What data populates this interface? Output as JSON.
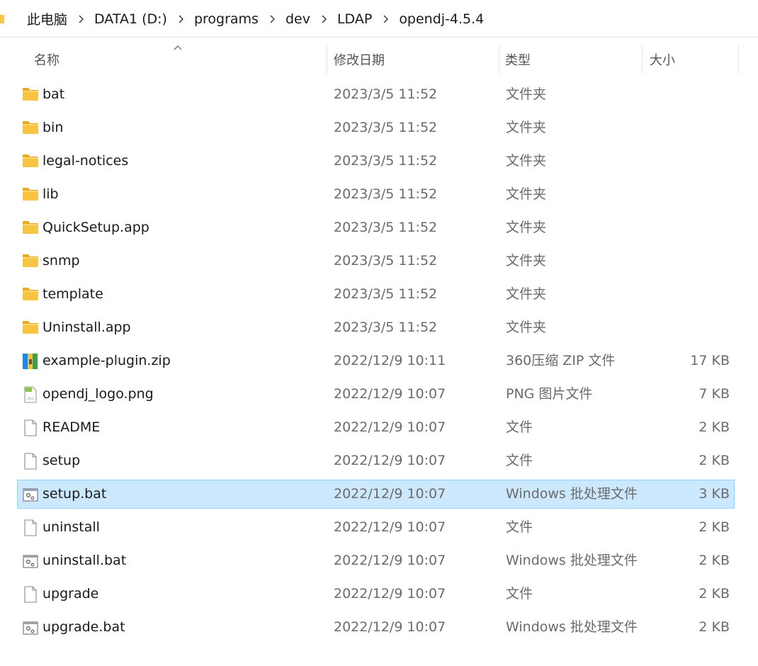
{
  "breadcrumb": [
    "此电脑",
    "DATA1 (D:)",
    "programs",
    "dev",
    "LDAP",
    "opendj-4.5.4"
  ],
  "columns": {
    "name": "名称",
    "modified": "修改日期",
    "type": "类型",
    "size": "大小"
  },
  "colors": {
    "selection_bg": "#cce8ff",
    "selection_border": "#99d1ff",
    "folder": "#f8c542"
  },
  "files": [
    {
      "name": "bat",
      "modified": "2023/3/5 11:52",
      "type": "文件夹",
      "size": "",
      "icon": "folder-icon"
    },
    {
      "name": "bin",
      "modified": "2023/3/5 11:52",
      "type": "文件夹",
      "size": "",
      "icon": "folder-icon"
    },
    {
      "name": "legal-notices",
      "modified": "2023/3/5 11:52",
      "type": "文件夹",
      "size": "",
      "icon": "folder-icon"
    },
    {
      "name": "lib",
      "modified": "2023/3/5 11:52",
      "type": "文件夹",
      "size": "",
      "icon": "folder-icon"
    },
    {
      "name": "QuickSetup.app",
      "modified": "2023/3/5 11:52",
      "type": "文件夹",
      "size": "",
      "icon": "folder-icon"
    },
    {
      "name": "snmp",
      "modified": "2023/3/5 11:52",
      "type": "文件夹",
      "size": "",
      "icon": "folder-icon"
    },
    {
      "name": "template",
      "modified": "2023/3/5 11:52",
      "type": "文件夹",
      "size": "",
      "icon": "folder-icon"
    },
    {
      "name": "Uninstall.app",
      "modified": "2023/3/5 11:52",
      "type": "文件夹",
      "size": "",
      "icon": "folder-icon"
    },
    {
      "name": "example-plugin.zip",
      "modified": "2022/12/9 10:11",
      "type": "360压缩 ZIP 文件",
      "size": "17 KB",
      "icon": "zip-archive-icon"
    },
    {
      "name": "opendj_logo.png",
      "modified": "2022/12/9 10:07",
      "type": "PNG 图片文件",
      "size": "7 KB",
      "icon": "image-file-icon"
    },
    {
      "name": "README",
      "modified": "2022/12/9 10:07",
      "type": "文件",
      "size": "2 KB",
      "icon": "file-icon"
    },
    {
      "name": "setup",
      "modified": "2022/12/9 10:07",
      "type": "文件",
      "size": "2 KB",
      "icon": "file-icon"
    },
    {
      "name": "setup.bat",
      "modified": "2022/12/9 10:07",
      "type": "Windows 批处理文件",
      "size": "3 KB",
      "icon": "batch-file-icon",
      "selected": true
    },
    {
      "name": "uninstall",
      "modified": "2022/12/9 10:07",
      "type": "文件",
      "size": "2 KB",
      "icon": "file-icon"
    },
    {
      "name": "uninstall.bat",
      "modified": "2022/12/9 10:07",
      "type": "Windows 批处理文件",
      "size": "2 KB",
      "icon": "batch-file-icon"
    },
    {
      "name": "upgrade",
      "modified": "2022/12/9 10:07",
      "type": "文件",
      "size": "2 KB",
      "icon": "file-icon"
    },
    {
      "name": "upgrade.bat",
      "modified": "2022/12/9 10:07",
      "type": "Windows 批处理文件",
      "size": "2 KB",
      "icon": "batch-file-icon"
    }
  ]
}
